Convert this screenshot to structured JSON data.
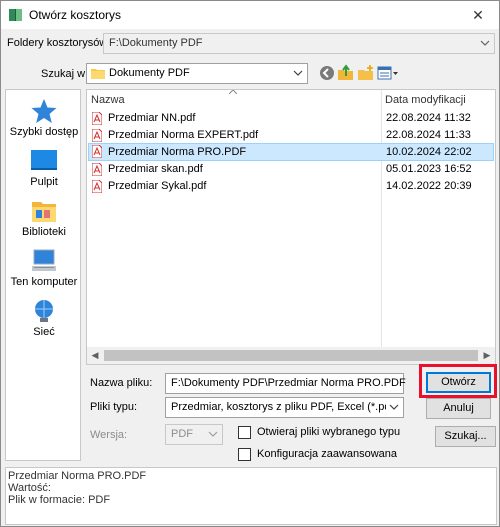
{
  "window": {
    "title": "Otwórz kosztorys",
    "close_glyph": "✕"
  },
  "folders": {
    "label": "Foldery kosztorysów:",
    "value": "F:\\Dokumenty PDF"
  },
  "lookin": {
    "label": "Szukaj w:",
    "value": "Dokumenty PDF"
  },
  "places": [
    {
      "label": "Szybki dostęp",
      "icon": "star-icon"
    },
    {
      "label": "Pulpit",
      "icon": "desktop-icon"
    },
    {
      "label": "Biblioteki",
      "icon": "libraries-icon"
    },
    {
      "label": "Ten komputer",
      "icon": "computer-icon"
    },
    {
      "label": "Sieć",
      "icon": "network-icon"
    }
  ],
  "filelist": {
    "col_name": "Nazwa",
    "col_date": "Data modyfikacji",
    "files": [
      {
        "name": "Przedmiar NN.pdf",
        "date": "22.08.2024 11:32",
        "selected": false
      },
      {
        "name": "Przedmiar Norma EXPERT.pdf",
        "date": "22.08.2024 11:33",
        "selected": false
      },
      {
        "name": "Przedmiar Norma PRO.PDF",
        "date": "10.02.2024 22:02",
        "selected": true
      },
      {
        "name": "Przedmiar skan.pdf",
        "date": "05.01.2023 16:52",
        "selected": false
      },
      {
        "name": "Przedmiar Sykal.pdf",
        "date": "14.02.2022 20:39",
        "selected": false
      }
    ]
  },
  "filename": {
    "label": "Nazwa pliku:",
    "value": "F:\\Dokumenty PDF\\Przedmiar Norma PRO.PDF"
  },
  "filetype": {
    "label": "Pliki typu:",
    "value": "Przedmiar, kosztorys z pliku PDF, Excel (*.pdf;*.xls;*.xls"
  },
  "version": {
    "label": "Wersja:",
    "value": "PDF"
  },
  "options": {
    "open_selected": "Otwieraj pliki wybranego typu",
    "advanced": "Konfiguracja zaawansowana"
  },
  "buttons": {
    "open": "Otwórz",
    "cancel": "Anuluj",
    "search": "Szukaj..."
  },
  "info": {
    "line1": "Przedmiar Norma PRO.PDF",
    "line2": "Wartość:",
    "line3": "Plik w formacie: PDF"
  },
  "colors": {
    "accent": "#0078d7",
    "highlight": "#e8102a",
    "selection": "#cce8ff",
    "pdf_red": "#d32f2f"
  }
}
